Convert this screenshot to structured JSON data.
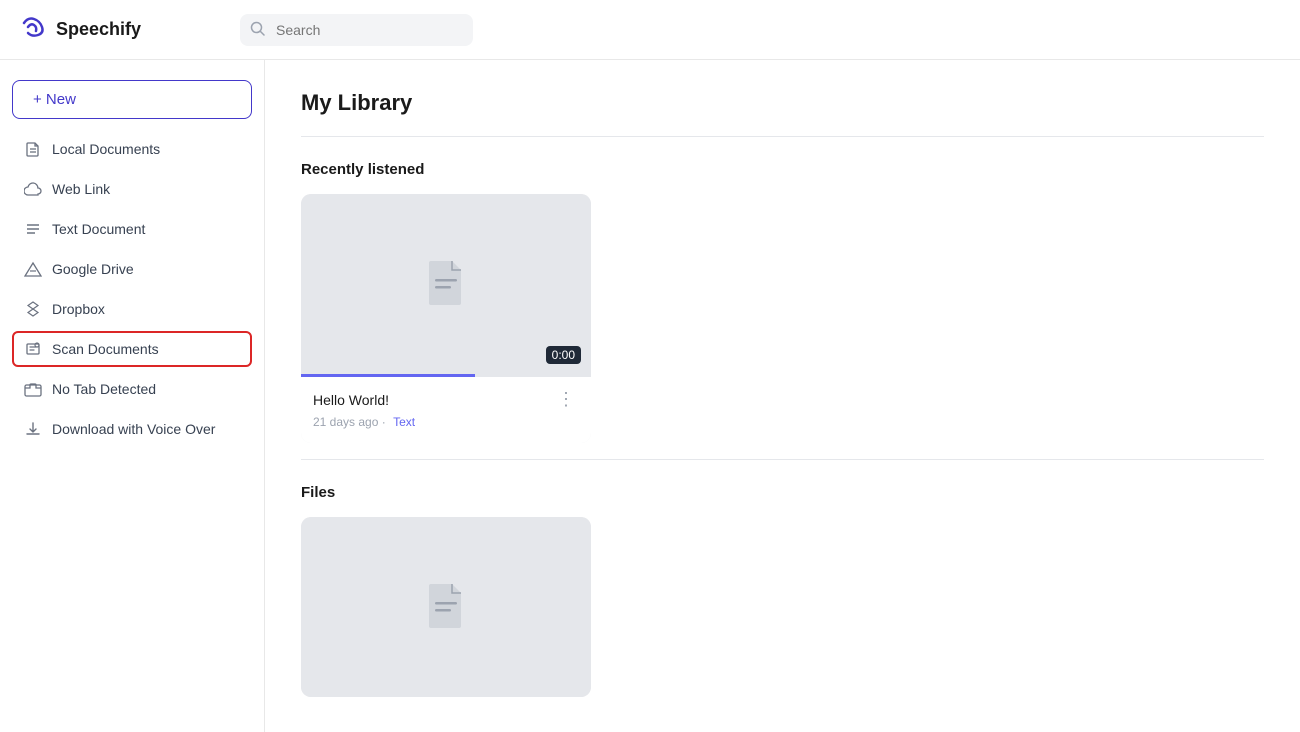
{
  "app": {
    "name": "Speechify",
    "logo_symbol": "〜"
  },
  "header": {
    "search_placeholder": "Search"
  },
  "sidebar": {
    "new_button_label": "+ New",
    "items": [
      {
        "id": "local-documents",
        "label": "Local Documents",
        "icon": "file"
      },
      {
        "id": "web-link",
        "label": "Web Link",
        "icon": "cloud"
      },
      {
        "id": "text-document",
        "label": "Text Document",
        "icon": "text"
      },
      {
        "id": "google-drive",
        "label": "Google Drive",
        "icon": "drive"
      },
      {
        "id": "dropbox",
        "label": "Dropbox",
        "icon": "dropbox"
      },
      {
        "id": "scan-documents",
        "label": "Scan Documents",
        "icon": "scan",
        "selected": true
      },
      {
        "id": "no-tab-detected",
        "label": "No Tab Detected",
        "icon": "tab"
      },
      {
        "id": "download-voice-over",
        "label": "Download with Voice Over",
        "icon": "download"
      }
    ]
  },
  "main": {
    "page_title": "My Library",
    "recently_listened_title": "Recently listened",
    "files_title": "Files",
    "cards": [
      {
        "id": "hello-world",
        "name": "Hello World!",
        "time": "0:00",
        "meta_age": "21 days ago",
        "meta_tag": "Text"
      }
    ]
  }
}
